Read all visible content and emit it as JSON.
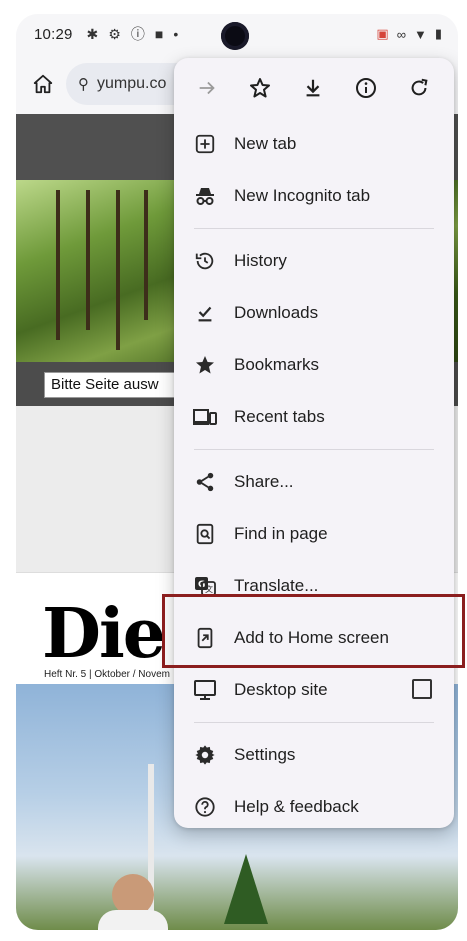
{
  "status_bar": {
    "time": "10:29",
    "icons_left": [
      "settings-icon",
      "gear-icon",
      "info-icon",
      "square-icon",
      "dot-icon"
    ],
    "icons_right": [
      "cast-icon",
      "infinity-icon",
      "wifi-icon",
      "battery-icon"
    ]
  },
  "address_bar": {
    "url": "yumpu.co"
  },
  "page": {
    "select_text": "Bitte Seite ausw",
    "magazine_title_black": "Die W",
    "magazine_subtitle": "Heft Nr. 5  |  Oktober / Novem"
  },
  "menu": {
    "top_actions": [
      {
        "name": "forward",
        "icon": "arrow-right-icon",
        "enabled": false
      },
      {
        "name": "bookmark",
        "icon": "star-outline-icon",
        "enabled": true
      },
      {
        "name": "download",
        "icon": "download-icon",
        "enabled": true
      },
      {
        "name": "page-info",
        "icon": "info-circle-icon",
        "enabled": true
      },
      {
        "name": "reload",
        "icon": "reload-icon",
        "enabled": true
      }
    ],
    "groups": [
      [
        {
          "label": "New tab",
          "icon": "plus-box-icon"
        },
        {
          "label": "New Incognito tab",
          "icon": "incognito-icon"
        }
      ],
      [
        {
          "label": "History",
          "icon": "history-icon"
        },
        {
          "label": "Downloads",
          "icon": "download-check-icon"
        },
        {
          "label": "Bookmarks",
          "icon": "star-filled-icon"
        },
        {
          "label": "Recent tabs",
          "icon": "devices-icon"
        }
      ],
      [
        {
          "label": "Share...",
          "icon": "share-icon"
        },
        {
          "label": "Find in page",
          "icon": "find-in-page-icon"
        },
        {
          "label": "Translate...",
          "icon": "translate-icon"
        },
        {
          "label": "Add to Home screen",
          "icon": "add-to-home-icon",
          "highlighted": true
        },
        {
          "label": "Desktop site",
          "icon": "desktop-icon",
          "checkbox": false
        }
      ],
      [
        {
          "label": "Settings",
          "icon": "settings-gear-icon"
        },
        {
          "label": "Help & feedback",
          "icon": "help-icon"
        }
      ]
    ]
  },
  "colors": {
    "highlight_border": "#8b1e1e",
    "menu_bg": "#f5f3f8",
    "magazine_red": "#c0181c"
  }
}
